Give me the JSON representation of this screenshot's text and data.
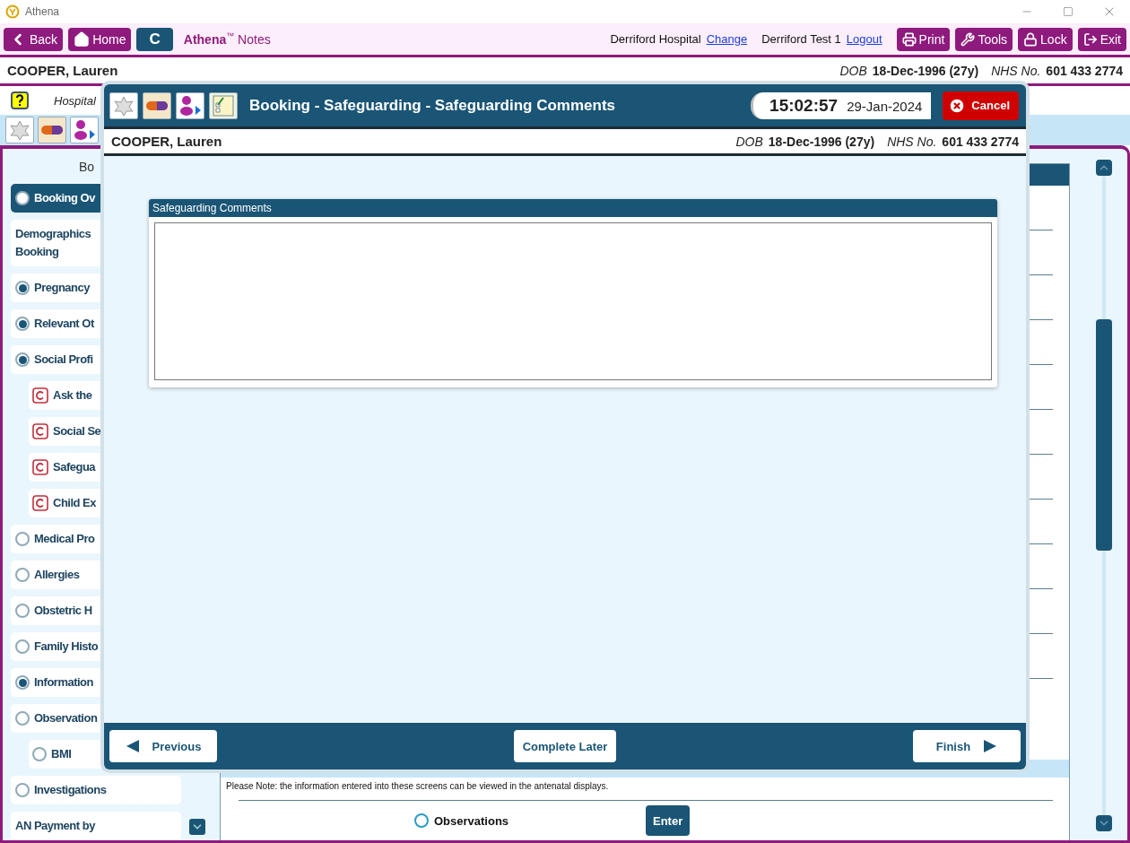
{
  "window": {
    "title": "Athena"
  },
  "topbar": {
    "nav": [
      {
        "kind": "back",
        "label": "Back"
      },
      {
        "kind": "home",
        "label": "Home"
      },
      {
        "kind": "letter",
        "label": "C"
      }
    ],
    "brand": "Athena",
    "brand_mark": "™",
    "brand_suffix": "Notes",
    "hospital": "Derriford Hospital",
    "hospital_link": "Change",
    "user": "Derriford Test 1",
    "user_link": "Logout",
    "actions": [
      {
        "kind": "print",
        "label": "Print"
      },
      {
        "kind": "tools",
        "label": "Tools"
      },
      {
        "kind": "lock",
        "label": "Lock"
      },
      {
        "kind": "exit",
        "label": "Exit"
      }
    ]
  },
  "patient": {
    "name": "COOPER, Lauren",
    "dob_label": "DOB",
    "dob": "18-Dec-1996 (27y)",
    "nhs_label": "NHS No.",
    "nhs": "601 433 2774"
  },
  "info_row": {
    "text": "Hospital"
  },
  "sidebar": {
    "heading": "Bo",
    "items": [
      {
        "kind": "radio",
        "label": "Booking Ov",
        "checked": false,
        "selected": true
      },
      {
        "kind": "plain",
        "label": "Demographics\nBooking",
        "selected": false
      },
      {
        "kind": "radio",
        "label": "Pregnancy",
        "checked": true,
        "selected": false
      },
      {
        "kind": "radio",
        "label": "Relevant Ot",
        "checked": true,
        "selected": false
      },
      {
        "kind": "radio",
        "label": "Social Profi",
        "checked": true,
        "selected": false,
        "children": [
          {
            "kind": "c",
            "label": "Ask the",
            "selected": false
          },
          {
            "kind": "c",
            "label": "Social Se",
            "selected": false
          },
          {
            "kind": "c",
            "label": "Safegua",
            "selected": false
          },
          {
            "kind": "c",
            "label": "Child Ex",
            "selected": false
          }
        ]
      },
      {
        "kind": "radio",
        "label": "Medical Pro",
        "checked": false,
        "selected": false
      },
      {
        "kind": "radio",
        "label": "Allergies",
        "checked": false,
        "selected": false
      },
      {
        "kind": "radio",
        "label": "Obstetric H",
        "checked": false,
        "selected": false
      },
      {
        "kind": "radio",
        "label": "Family Histo",
        "checked": false,
        "selected": false
      },
      {
        "kind": "radio",
        "label": "Information",
        "checked": true,
        "selected": false
      },
      {
        "kind": "radio",
        "label": "Observation",
        "checked": false,
        "selected": false,
        "children": [
          {
            "kind": "radio",
            "label": "BMI",
            "checked": false,
            "selected": false
          }
        ]
      },
      {
        "kind": "radio",
        "label": "Investigations",
        "checked": false,
        "selected": false
      },
      {
        "kind": "plain",
        "label": "AN Payment by",
        "selected": false
      }
    ]
  },
  "content": {
    "note": "Please Note: the information entered into these screens can be viewed in the antenatal displays.",
    "observations": {
      "label": "Observations",
      "checked": false
    },
    "enter": "Enter"
  },
  "dialog": {
    "title": "Booking - Safeguarding - Safeguarding Comments",
    "time": "15:02:57",
    "date": "29-Jan-2024",
    "cancel": "Cancel",
    "patient": {
      "name": "COOPER, Lauren",
      "dob_label": "DOB",
      "dob": "18-Dec-1996 (27y)",
      "nhs_label": "NHS No.",
      "nhs": "601 433 2774"
    },
    "section": {
      "title": "Safeguarding Comments"
    },
    "buttons": [
      {
        "kind": "previous",
        "label": "Previous"
      },
      {
        "kind": "later",
        "label": "Complete Later"
      },
      {
        "kind": "finish",
        "label": "Finish"
      }
    ]
  }
}
